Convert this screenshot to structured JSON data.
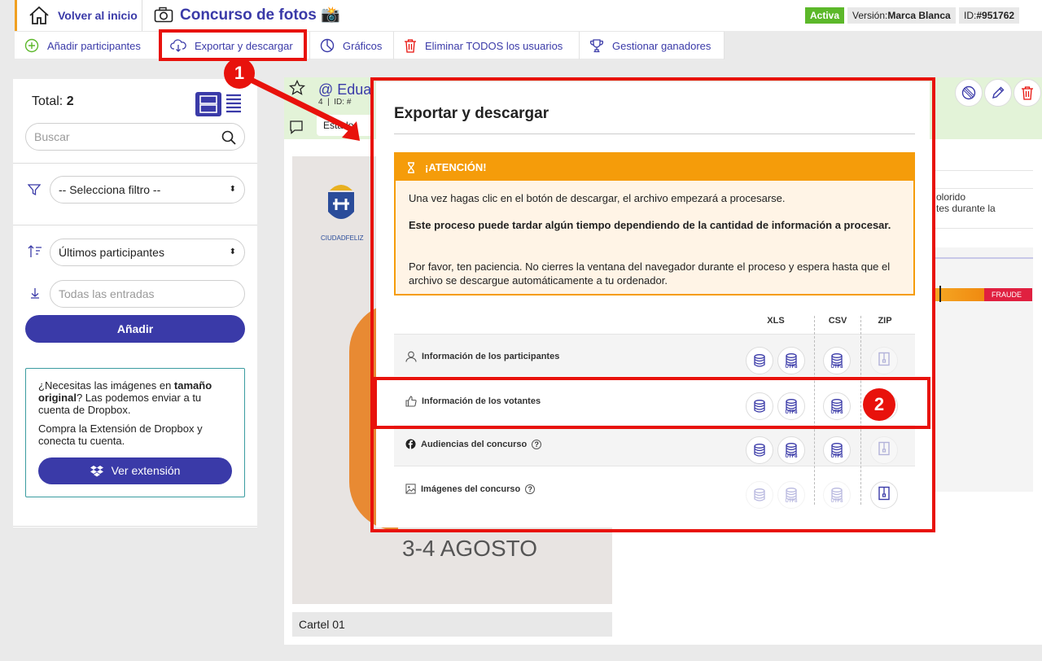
{
  "header": {
    "home_label": "Volver al inicio",
    "contest_title": "Concurso de fotos 📸",
    "status_badge": "Activa",
    "version_prefix": "Versión: ",
    "version_value": "Marca Blanca",
    "id_prefix": "ID: ",
    "id_value": "#951762"
  },
  "toolbar": {
    "items": [
      {
        "label": "Añadir participantes",
        "icon": "plus-circle-icon"
      },
      {
        "label": "Exportar y descargar",
        "icon": "cloud-download-icon"
      },
      {
        "label": "Gráficos",
        "icon": "pie-chart-icon"
      },
      {
        "label": "Eliminar TODOS los usuarios",
        "icon": "trash-icon"
      },
      {
        "label": "Gestionar ganadores",
        "icon": "trophy-icon"
      }
    ]
  },
  "annotations": {
    "step1": "1",
    "step2": "2"
  },
  "sidebar": {
    "total_label": "Total: ",
    "total_value": "2",
    "search_placeholder": "Buscar",
    "filter_value": "-- Selecciona filtro --",
    "order_value": "Últimos participantes",
    "entries_placeholder": "Todas las entradas",
    "add_button": "Añadir",
    "dropbox": {
      "text_before": "¿Necesitas las imágenes en ",
      "text_bold": "tamaño original",
      "text_after": "? Las podemos enviar a tu cuenta de Dropbox.",
      "text2": "Compra la Extensión de Dropbox y conecta tu cuenta.",
      "button": "Ver extensión"
    }
  },
  "background_content": {
    "participant_name": "@ Edua",
    "meta_1": "4",
    "meta_2": "ID: #",
    "state_label": "Estado:",
    "poster_city": "CIUDADFELIZ",
    "poster_dates": "3-4 AGOSTO",
    "poster_caption": "Cartel 01",
    "right_text_1": "olorido",
    "right_text_2": "tes durante la",
    "fraud_label": "FRAUDE"
  },
  "modal": {
    "title": "Exportar y descargar",
    "alert": {
      "heading": "¡ATENCIÓN!",
      "p1": "Una vez hagas clic en el botón de descargar, el archivo empezará a procesarse.",
      "p2": "Este proceso puede tardar algún tiempo dependiendo de la cantidad de información a procesar.",
      "p3": "Por favor, ten paciencia. No cierres la ventana del navegador durante el proceso y espera hasta que el archivo se descargue automáticamente a tu ordenador."
    },
    "columns": {
      "xls": "XLS",
      "csv": "CSV",
      "zip": "ZIP"
    },
    "rows": [
      {
        "label": "Información de los participantes",
        "icon": "user-icon",
        "utf8": "UTF8"
      },
      {
        "label": "Información de los votantes",
        "icon": "thumbs-up-icon",
        "utf8": "UTF8"
      },
      {
        "label": "Audiencias del concurso",
        "icon": "facebook-icon",
        "utf8": "UTF8"
      },
      {
        "label": "Imágenes del concurso",
        "icon": "image-icon",
        "utf8": "UTF8"
      }
    ]
  },
  "colors": {
    "brand": "#3a3aa8",
    "highlight": "#e8120c",
    "alert": "#f59c0a",
    "active": "#5cb82a"
  }
}
